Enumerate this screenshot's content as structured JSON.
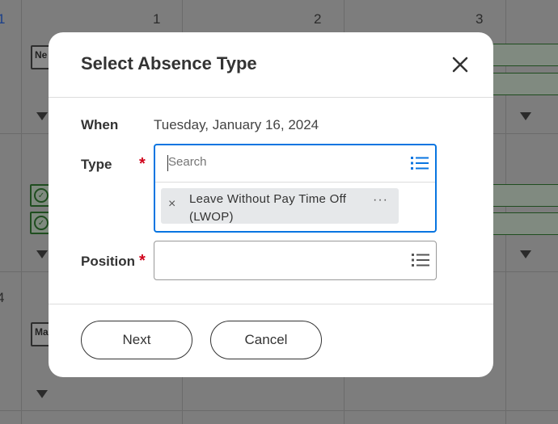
{
  "calendar": {
    "day_numbers": [
      "1",
      "2",
      "3",
      "4"
    ],
    "chip_labels": [
      "Ne",
      "Ma"
    ]
  },
  "dialog": {
    "title": "Select Absence Type",
    "close_icon": "close-icon",
    "fields": {
      "when": {
        "label": "When",
        "value": "Tuesday, January 16, 2024"
      },
      "type": {
        "label": "Type",
        "required_mark": "*",
        "search_placeholder": "Search",
        "selected_item": "Leave Without Pay Time Off (LWOP)",
        "remove_icon": "×",
        "more_icon": "···"
      },
      "position": {
        "label": "Position",
        "required_mark": "*",
        "value": ""
      }
    },
    "buttons": {
      "next": "Next",
      "cancel": "Cancel"
    }
  },
  "colors": {
    "accent": "#0875e1",
    "required": "#d0021b",
    "overlay": "#7d7d7d"
  }
}
